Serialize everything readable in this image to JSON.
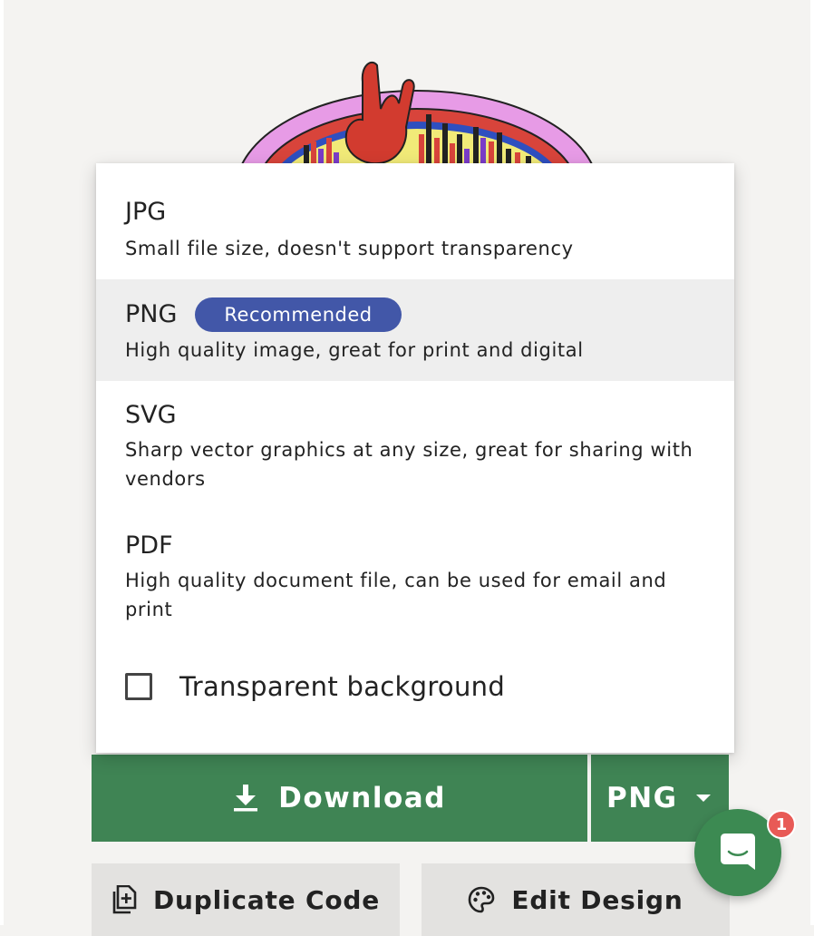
{
  "format_menu": {
    "options": [
      {
        "title": "JPG",
        "description": "Small file size, doesn't support transparency"
      },
      {
        "title": "PNG",
        "badge": "Recommended",
        "description": "High quality image, great for print and digital",
        "selected": true
      },
      {
        "title": "SVG",
        "description": "Sharp vector graphics at any size, great for sharing with vendors"
      },
      {
        "title": "PDF",
        "description": "High quality document file, can be used for email and print"
      }
    ],
    "transparent_background": {
      "label": "Transparent background",
      "checked": false
    }
  },
  "download_bar": {
    "download_label": "Download",
    "format_value": "PNG"
  },
  "secondary_actions": {
    "duplicate_label": "Duplicate Code",
    "edit_label": "Edit Design"
  },
  "chat_widget": {
    "unread_count": "1"
  },
  "colors": {
    "primary_green": "#3f8454",
    "badge_blue": "#4257a8",
    "selected_row": "#eeeeee",
    "notification_red": "#e85a56"
  },
  "icons": [
    "rock-hand-artwork",
    "download-icon",
    "caret-down-icon",
    "duplicate-icon",
    "palette-icon",
    "chat-icon"
  ]
}
